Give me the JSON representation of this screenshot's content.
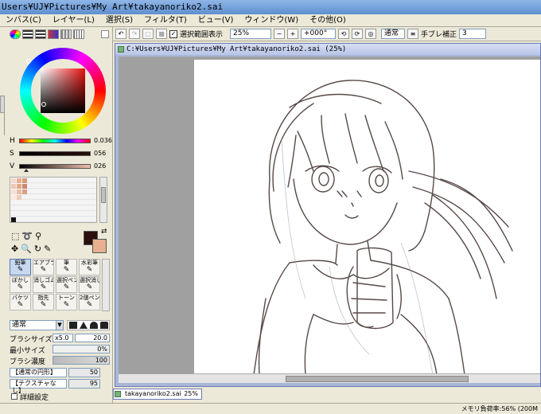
{
  "window": {
    "title": "Users¥UJ¥Pictures¥My Art¥takayanoriko2.sai"
  },
  "menu": [
    "ンバス(C)",
    "レイヤー(L)",
    "選択(S)",
    "フィルタ(T)",
    "ビュー(V)",
    "ウィンドウ(W)",
    "その他(O)"
  ],
  "toolbar": {
    "selection_checkbox_label": "選択範囲表示",
    "selection_checked": true,
    "zoom": "25%",
    "rotation": "+000°",
    "blend_mode": "通常",
    "stabilizer_label": "手ブレ補正",
    "stabilizer_value": "3"
  },
  "color": {
    "h_label": "H",
    "h_value": "0.036",
    "s_label": "S",
    "s_value": "056",
    "v_label": "V",
    "v_value": "026",
    "foreground": "#2a0f0c",
    "background": "#e8b090"
  },
  "tools": [
    {
      "label": "鉛筆",
      "selected": true
    },
    {
      "label": "エアブラシ",
      "selected": false
    },
    {
      "label": "筆",
      "selected": false
    },
    {
      "label": "水彩筆",
      "selected": false
    },
    {
      "label": "ぼかし",
      "selected": false
    },
    {
      "label": "消しゴム",
      "selected": false
    },
    {
      "label": "選択ペン",
      "selected": false
    },
    {
      "label": "選択消し",
      "selected": false
    },
    {
      "label": "バケツ",
      "selected": false
    },
    {
      "label": "指先",
      "selected": false
    },
    {
      "label": "トーン",
      "selected": false
    },
    {
      "label": "2値ペン",
      "selected": false
    }
  ],
  "brush": {
    "blend_mode": "通常",
    "size_label": "ブラシサイズ",
    "size_mult": "x5.0",
    "size_value": "20.0",
    "min_size_label": "最小サイズ",
    "min_size_value": "0%",
    "density_label": "ブラシ濃度",
    "density_value": "100",
    "shape_select": "【通常の円形】",
    "shape_strength": "50",
    "texture_select": "【テクスチャなし】",
    "texture_strength": "95",
    "advanced_label": "詳細設定"
  },
  "document": {
    "title": "C:¥Users¥UJ¥Pictures¥My Art¥takayanoriko2.sai (25%)",
    "tab_name": "takayanoriko2.sai",
    "tab_zoom": "25%"
  },
  "status": {
    "memory": "メモリ負荷率:56% (200M"
  },
  "colors": {
    "accent": "#6b7bb5",
    "panel": "#ece9d8",
    "titlebar": "#5e8fcf"
  }
}
